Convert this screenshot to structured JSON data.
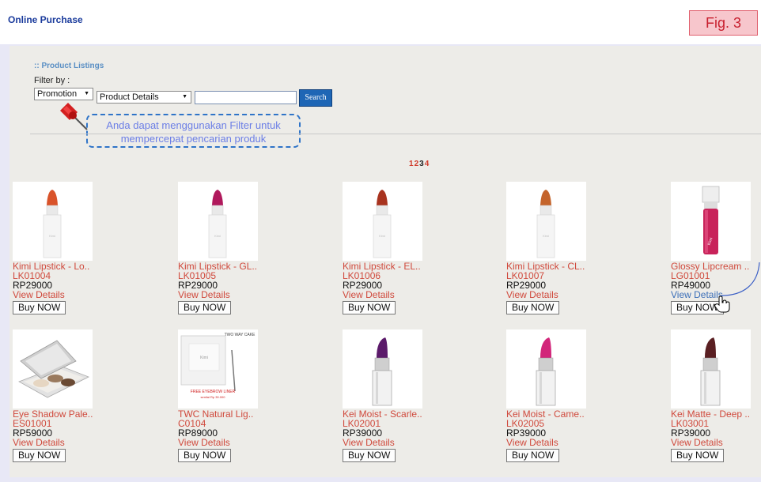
{
  "header": {
    "title": "Online Purchase",
    "fig": "Fig. 3"
  },
  "listing": {
    "title": ":: Product Listings",
    "filter_label": "Filter by :",
    "filter_select": "Promotion",
    "detail_select": "Product Details",
    "search_value": "",
    "search_button": "Search"
  },
  "tip": {
    "line1": "Anda dapat menggunakan Filter untuk",
    "line2": "mempercepat pencarian produk"
  },
  "pagination": [
    "1",
    "2",
    "3",
    "4"
  ],
  "pagination_current": "3",
  "products": [
    {
      "name": "Kimi Lipstick - Lo..",
      "code": "LK01004",
      "price": "RP29000",
      "view": "View Details",
      "buy": "Buy NOW",
      "color": "#d9532a",
      "kind": "lipstick-white"
    },
    {
      "name": "Kimi Lipstick - GL..",
      "code": "LK01005",
      "price": "RP29000",
      "view": "View Details",
      "buy": "Buy NOW",
      "color": "#b0195c",
      "kind": "lipstick-white"
    },
    {
      "name": "Kimi Lipstick - EL..",
      "code": "LK01006",
      "price": "RP29000",
      "view": "View Details",
      "buy": "Buy NOW",
      "color": "#a8331f",
      "kind": "lipstick-white"
    },
    {
      "name": "Kimi Lipstick - CL..",
      "code": "LK01007",
      "price": "RP29000",
      "view": "View Details",
      "buy": "Buy NOW",
      "color": "#c4642c",
      "kind": "lipstick-white"
    },
    {
      "name": "Glossy Lipcream ..",
      "code": "LG01001",
      "price": "RP49000",
      "view": "View Details",
      "buy": "Buy NOW",
      "color": "#c8235a",
      "kind": "lipcream"
    },
    {
      "name": "Eye Shadow Pale..",
      "code": "ES01001",
      "price": "RP59000",
      "view": "View Details",
      "buy": "Buy NOW",
      "color": "#7a5a40",
      "kind": "palette"
    },
    {
      "name": "TWC Natural Lig..",
      "code": "C0104",
      "price": "RP89000",
      "view": "View Details",
      "buy": "Buy NOW",
      "color": "#cccccc",
      "kind": "twc",
      "box_text": "TWO WAY CAKE",
      "promo_text": "FREE EYEBROW LINER",
      "promo_price": "senilai Rp 39.000"
    },
    {
      "name": "Kei Moist - Scarle..",
      "code": "LK02001",
      "price": "RP39000",
      "view": "View Details",
      "buy": "Buy NOW",
      "color": "#5b1a6a",
      "kind": "lipstick-silver"
    },
    {
      "name": "Kei Moist - Came..",
      "code": "LK02005",
      "price": "RP39000",
      "view": "View Details",
      "buy": "Buy NOW",
      "color": "#d2257a",
      "kind": "lipstick-silver"
    },
    {
      "name": "Kei Matte - Deep ..",
      "code": "LK03001",
      "price": "RP39000",
      "view": "View Details",
      "buy": "Buy NOW",
      "color": "#5a1f22",
      "kind": "lipstick-silver"
    }
  ],
  "hovered_index": 4
}
